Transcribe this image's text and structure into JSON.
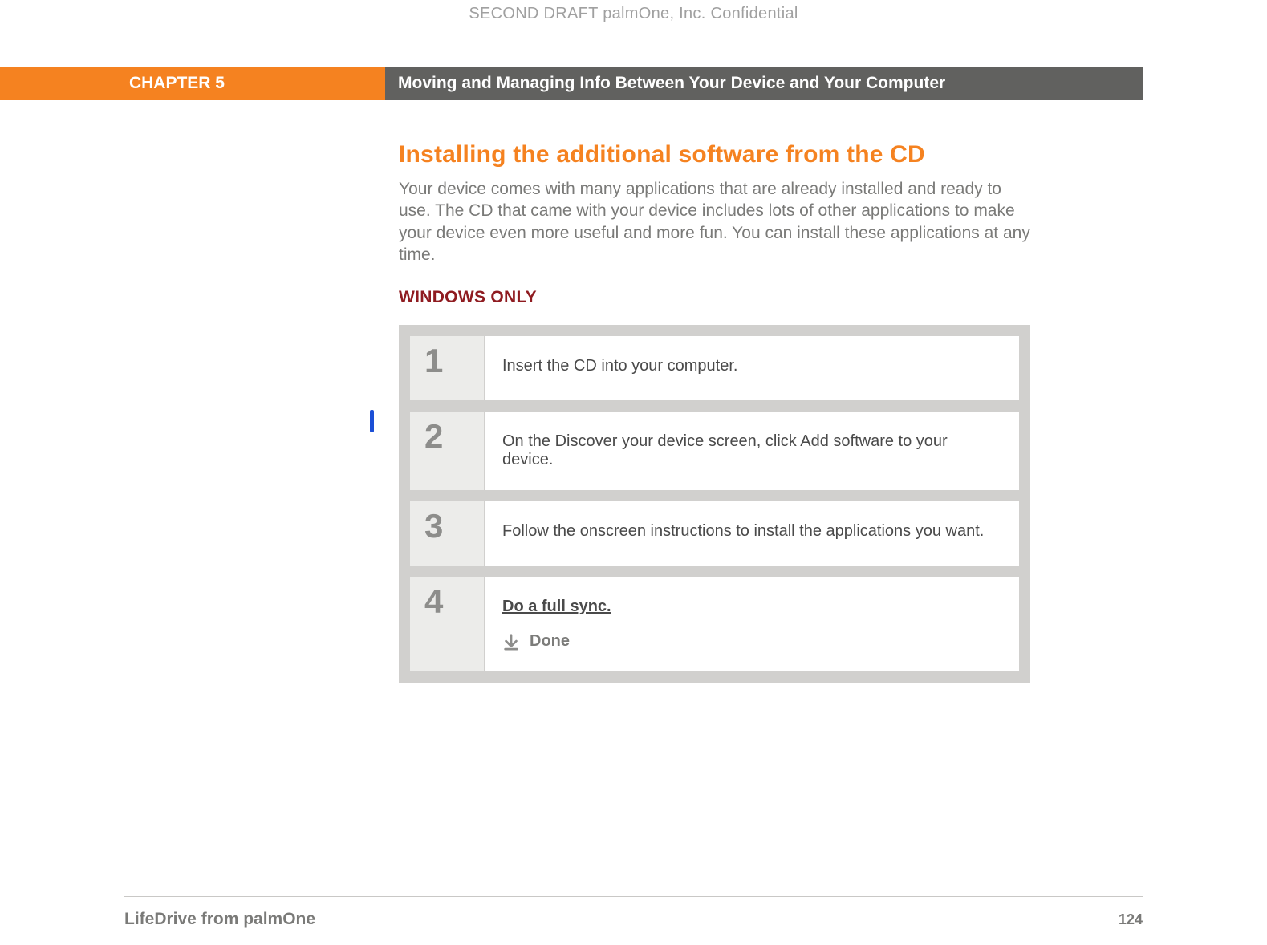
{
  "confidential": "SECOND DRAFT palmOne, Inc.  Confidential",
  "band": {
    "chapter": "CHAPTER 5",
    "title": "Moving and Managing Info Between Your Device and Your Computer"
  },
  "section_heading": "Installing the additional software from the CD",
  "intro": "Your device comes with many applications that are already installed and ready to use. The CD that came with your device includes lots of other applications to make your device even more useful and more fun. You can install these applications at any time.",
  "subhead": "WINDOWS ONLY",
  "steps": [
    {
      "num": "1",
      "text": "Insert the CD into your computer."
    },
    {
      "num": "2",
      "text": "On the Discover your device screen, click Add software to your device."
    },
    {
      "num": "3",
      "text": "Follow the onscreen instructions to install the applications you want."
    },
    {
      "num": "4",
      "link": "Do a full sync.",
      "done": "Done"
    }
  ],
  "footer": {
    "product": "LifeDrive from palmOne",
    "page": "124"
  }
}
